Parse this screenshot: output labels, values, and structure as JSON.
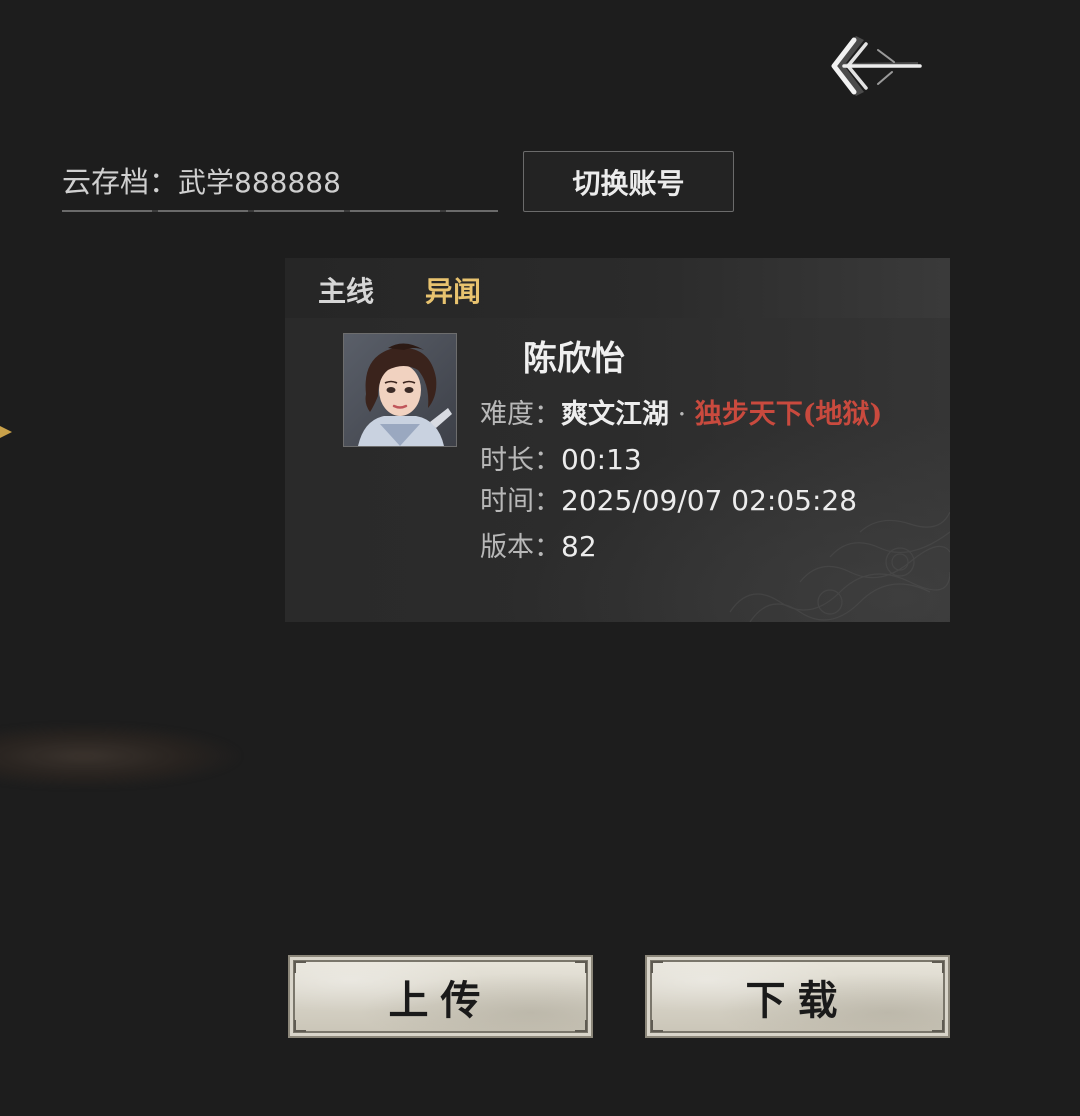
{
  "header": {
    "back_icon": "back-arrow-icon"
  },
  "cloud_save": {
    "label": "云存档：",
    "account": "武学888888",
    "switch_button_label": "切换账号"
  },
  "tabs": [
    {
      "label": "主线",
      "active": false
    },
    {
      "label": "异闻",
      "active": true
    }
  ],
  "save_slot": {
    "character_name": "陈欣怡",
    "difficulty_label": "难度：",
    "difficulty_value": "爽文江湖",
    "difficulty_separator": " · ",
    "difficulty_hard": "独步天下(地狱)",
    "duration_label": "时长：",
    "duration_value": "00:13",
    "time_label": "时间：",
    "time_value": "2025/09/07 02:05:28",
    "version_label": "版本：",
    "version_value": "82"
  },
  "actions": {
    "upload_label": "上传",
    "download_label": "下载"
  },
  "colors": {
    "background": "#1d1d1d",
    "active_tab": "#e8c36f",
    "hard_difficulty": "#c94a3e"
  }
}
